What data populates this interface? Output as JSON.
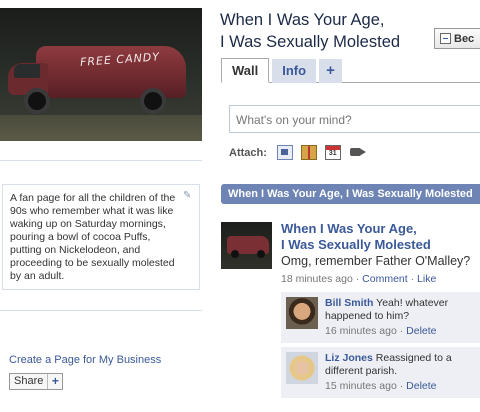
{
  "profile_photo": {
    "van_text": "FREE CANDY"
  },
  "about": {
    "text": "A fan page for all the children of the 90s who remember what it was like waking up on Saturday mornings, pouring a bowl of cocoa Puffs, putting on Nickelodeon, and proceeding to be sexually molested by an adult."
  },
  "left_links": {
    "create_page": "Create a Page for My Business",
    "share_label": "Share",
    "share_plus": "+"
  },
  "header": {
    "title_line1": "When I Was Your Age,",
    "title_line2": "I Was Sexually Molested",
    "become_fan_label": "Bec"
  },
  "tabs": [
    {
      "label": "Wall"
    },
    {
      "label": "Info"
    },
    {
      "label": "+"
    }
  ],
  "publisher": {
    "placeholder": "What's on your mind?",
    "attach_label": "Attach:"
  },
  "wall_banner": "When I Was Your Age, I Was Sexually Molested",
  "post": {
    "title_line1": "When I Was Your Age,",
    "title_line2": "I Was Sexually Molested",
    "body": "Omg, remember Father O'Malley?",
    "time": "18 minutes ago",
    "sep1": " · ",
    "comment_link": "Comment",
    "sep2": " · ",
    "like_link": "Like"
  },
  "comments": [
    {
      "name": "Bill Smith",
      "text": " Yeah! whatever happened to him?",
      "time": "16 minutes ago",
      "sep": " · ",
      "delete": "Delete"
    },
    {
      "name": "Liz Jones",
      "text": " Reassigned to a different parish.",
      "time": "15 minutes ago",
      "sep": " · ",
      "delete": "Delete"
    }
  ],
  "colors": {
    "link": "#3b5998",
    "banner": "#6d84b4",
    "comment_bg": "#edeff4",
    "tab_bg": "#d8dfea"
  }
}
